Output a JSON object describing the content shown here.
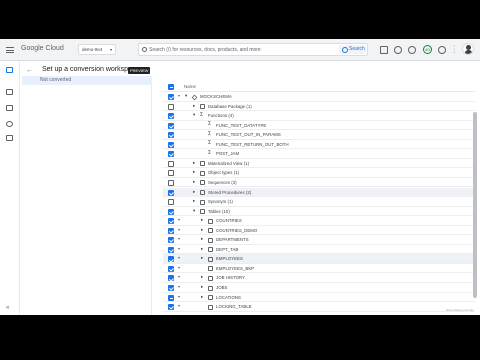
{
  "topbar": {
    "brand": "Google Cloud",
    "project": "demo-0e4",
    "search_placeholder": "Search (/) for resources, docs, products, and more",
    "search_button": "Search",
    "notification_count": "40"
  },
  "page": {
    "title": "Set up a conversion workspace",
    "badge": "PREVIEW",
    "left_status": "Not converted"
  },
  "tree": {
    "header": "Name",
    "rows": [
      {
        "label": "MOCKSCHEMA",
        "level": 0,
        "arrow": "▾",
        "checked": "on",
        "icon": "schema"
      },
      {
        "label": "Database Package (1)",
        "level": 1,
        "arrow": "▸",
        "checked": "off",
        "icon": "box"
      },
      {
        "label": "Functions (4)",
        "level": 1,
        "arrow": "▾",
        "checked": "on",
        "icon": "fn"
      },
      {
        "label": "FUNC_TEST_DATATYPE",
        "level": 2,
        "arrow": "",
        "checked": "on",
        "icon": "fn"
      },
      {
        "label": "FUNC_TEST_OUT_IN_PARAMS",
        "level": 2,
        "arrow": "",
        "checked": "on",
        "icon": "fn"
      },
      {
        "label": "FUNC_TEST_RETURN_OUT_BOTH",
        "level": 2,
        "arrow": "",
        "checked": "on",
        "icon": "fn"
      },
      {
        "label": "POST_JAM",
        "level": 2,
        "arrow": "",
        "checked": "on",
        "icon": "fn"
      },
      {
        "label": "Materialized View (1)",
        "level": 1,
        "arrow": "▸",
        "checked": "off",
        "icon": "box"
      },
      {
        "label": "Object types (1)",
        "level": 1,
        "arrow": "▸",
        "checked": "off",
        "icon": "box"
      },
      {
        "label": "Sequences (3)",
        "level": 1,
        "arrow": "▸",
        "checked": "off",
        "icon": "box"
      },
      {
        "label": "Stored Procedures (2)",
        "level": 1,
        "arrow": "▸",
        "checked": "on",
        "icon": "box",
        "highlight": true
      },
      {
        "label": "Synonym (1)",
        "level": 1,
        "arrow": "▸",
        "checked": "off",
        "icon": "box"
      },
      {
        "label": "Tables (10)",
        "level": 1,
        "arrow": "▾",
        "checked": "on",
        "icon": "box"
      },
      {
        "label": "COUNTRIES",
        "level": 2,
        "arrow": "▸",
        "checked": "on",
        "icon": "table",
        "dropdown": true
      },
      {
        "label": "COUNTRIES_DEMO",
        "level": 2,
        "arrow": "▸",
        "checked": "on",
        "icon": "table",
        "dropdown": true
      },
      {
        "label": "DEPARTMENTS",
        "level": 2,
        "arrow": "▸",
        "checked": "on",
        "icon": "table",
        "dropdown": true
      },
      {
        "label": "DEPT_TAB",
        "level": 2,
        "arrow": "▸",
        "checked": "on",
        "icon": "table",
        "dropdown": true
      },
      {
        "label": "EMPLOYEES",
        "level": 2,
        "arrow": "▸",
        "checked": "on",
        "icon": "table",
        "dropdown": true,
        "highlight": true
      },
      {
        "label": "EMPLOYEES_BKP",
        "level": 2,
        "arrow": "",
        "checked": "on",
        "icon": "table",
        "dropdown": true
      },
      {
        "label": "JOB HISTORY",
        "level": 2,
        "arrow": "▸",
        "checked": "on",
        "icon": "table",
        "dropdown": true
      },
      {
        "label": "JOBS",
        "level": 2,
        "arrow": "▸",
        "checked": "on",
        "icon": "table",
        "dropdown": true
      },
      {
        "label": "LOCATIONS",
        "level": 2,
        "arrow": "▸",
        "checked": "part",
        "icon": "table",
        "dropdown": true
      },
      {
        "label": "LOCKING_TABLE",
        "level": 2,
        "arrow": "",
        "checked": "on",
        "icon": "table",
        "dropdown": true
      }
    ]
  },
  "watermark": "Show debug console"
}
